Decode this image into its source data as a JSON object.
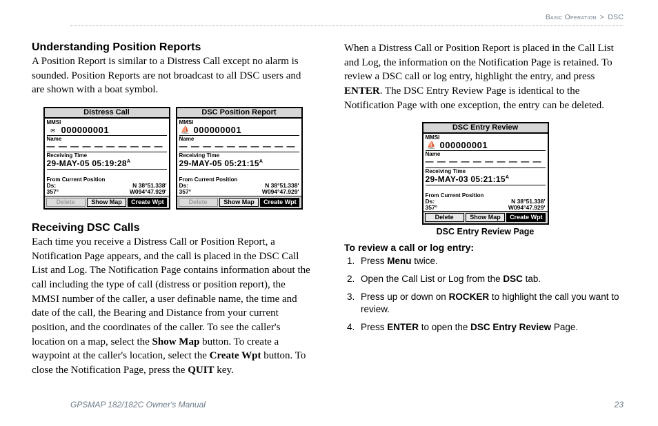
{
  "breadcrumb": {
    "section": "Basic Operation",
    "sep": ">",
    "page": "DSC"
  },
  "left": {
    "h1": "Understanding Position Reports",
    "p1": "A Position Report is similar to a Distress Call except no alarm is sounded. Position Reports are not broadcast to all DSC users and are shown with a boat symbol.",
    "h2": "Receiving DSC Calls",
    "p2a": "Each time you receive a Distress Call or Position Report, a Notification Page appears, and the call is placed in the DSC Call List and Log. The Notification Page contains information about the call including the type of call (distress or position report), the MMSI number of the caller, a user definable name, the time and date of the call, the Bearing and Distance from your current position, and the coordinates of the caller. To see the caller's location on a map, select the ",
    "p2b": " button. To create a waypoint at the caller's location, select the ",
    "p2c": " button. To close the Notification Page, press the ",
    "p2d": " key.",
    "kw_showmap": "Show Map",
    "kw_createwpt": "Create Wpt",
    "kw_quit": "QUIT"
  },
  "right": {
    "p1a": "When a Distress Call or Position Report is placed in the Call List and Log, the information on the Notification Page is retained. To review a DSC call or log entry, highlight the entry, and press ",
    "p1b": ". The DSC Entry Review Page is identical to the Notification Page with one exception, the entry can be deleted.",
    "kw_enter": "ENTER",
    "figcap": "DSC Entry Review Page",
    "steps_title": "To review a call or log entry:",
    "steps": {
      "s1a": "Press ",
      "s1b": " twice.",
      "s1kw": "Menu",
      "s2a": "Open the Call List or Log from the ",
      "s2b": " tab.",
      "s2kw": "DSC",
      "s3a": "Press up or down on ",
      "s3b": " to highlight the call you want to review.",
      "s3kw": "ROCKER",
      "s4a": "Press ",
      "s4b": " to open the ",
      "s4c": " Page.",
      "s4kw1": "ENTER",
      "s4kw2": "DSC Entry Review"
    }
  },
  "figA": {
    "title": "Distress Call",
    "mmsi_label": "MMSI",
    "mmsi": "000000001",
    "icon": "✉",
    "name_label": "Name",
    "name": "— — — — — — — — — —",
    "time_label": "Receiving Time",
    "time": "29-MAY-05   05:19:28",
    "time_suffix": "A",
    "from_label": "From Current Position",
    "pos_left1": "Ds:",
    "pos_left2": "357°",
    "pos_right1": "N  38°51.338'",
    "pos_right2": "W094°47.929'",
    "btn1": "Delete",
    "btn2": "Show Map",
    "btn3": "Create Wpt"
  },
  "figB": {
    "title": "DSC Position Report",
    "mmsi_label": "MMSI",
    "mmsi": "000000001",
    "icon": "⛵",
    "name_label": "Name",
    "name": "— — — — — — — — — —",
    "time_label": "Receiving Time",
    "time": "29-MAY-05   05:21:15",
    "time_suffix": "A",
    "from_label": "From Current Position",
    "pos_left1": "Ds:",
    "pos_left2": "357°",
    "pos_right1": "N  38°51.338'",
    "pos_right2": "W094°47.929'",
    "btn1": "Delete",
    "btn2": "Show Map",
    "btn3": "Create Wpt"
  },
  "figC": {
    "title": "DSC Entry Review",
    "mmsi_label": "MMSI",
    "mmsi": "000000001",
    "icon": "⛵",
    "name_label": "Name",
    "name": "— — — — — — — — — —",
    "time_label": "Receiving Time",
    "time": "29-MAY-03   05:21:15",
    "time_suffix": "A",
    "from_label": "From Current Position",
    "pos_left1": "Ds:",
    "pos_left2": "357°",
    "pos_right1": "N  38°51.338'",
    "pos_right2": "W094°47.929'",
    "btn1": "Delete",
    "btn2": "Show Map",
    "btn3": "Create Wpt"
  },
  "footer": {
    "left": "GPSMAP 182/182C Owner's Manual",
    "right": "23"
  }
}
